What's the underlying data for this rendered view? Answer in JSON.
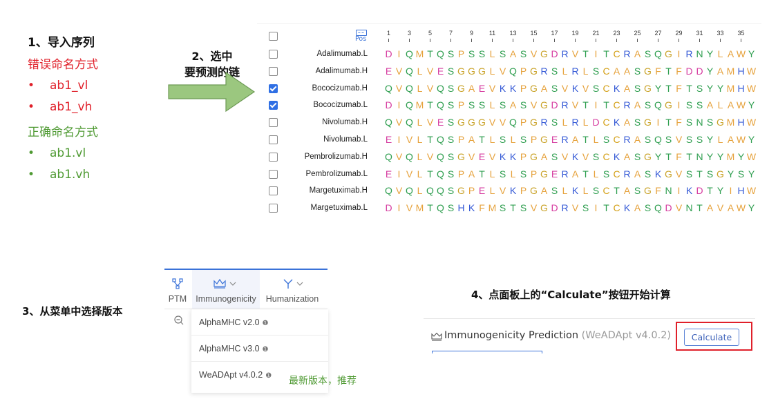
{
  "step1": {
    "heading": "1、导入序列",
    "wrong_title": "错误命名方式",
    "wrong_items": [
      "ab1_vl",
      "ab1_vh"
    ],
    "right_title": "正确命名方式",
    "right_items": [
      "ab1.vl",
      "ab1.vh"
    ]
  },
  "step2": {
    "line1": "2、选中",
    "line2": "要预测的链"
  },
  "sequences": {
    "pos_label": "Pos",
    "ticks": [
      "1",
      "3",
      "5",
      "7",
      "9",
      "11",
      "13",
      "15",
      "17",
      "19",
      "21",
      "23",
      "25",
      "27",
      "29",
      "31",
      "33",
      "35"
    ],
    "rows": [
      {
        "name": "Adalimumab.L",
        "checked": false,
        "seq": "DIQMTQSPSSLSASVGDRVTITCRASQGIRNYLAWY"
      },
      {
        "name": "Adalimumab.H",
        "checked": false,
        "seq": "EVQLVESGGGLVQPGRSLRLSCAASGFTFDDYAMHW"
      },
      {
        "name": "Bococizumab.H",
        "checked": true,
        "seq": "QVQLVQSGAEVKKPGASVKVSCKASGYTFTSYYMHW"
      },
      {
        "name": "Bococizumab.L",
        "checked": true,
        "seq": "DIQMTQSPSSLSASVGDRVTITCRASQGISSALAWY"
      },
      {
        "name": "Nivolumab.H",
        "checked": false,
        "seq": "QVQLVESGGGVVQPGRSLRLDCKASGITFSNSGMHW"
      },
      {
        "name": "Nivolumab.L",
        "checked": false,
        "seq": "EIVLTQSPATLSLSPGERATLSCRASQSVSSYLAWY"
      },
      {
        "name": "Pembrolizumab.H",
        "checked": false,
        "seq": "QVQLVQSGVEVKKPGASVKVSCKASGYTFTNYYMYW"
      },
      {
        "name": "Pembrolizumab.L",
        "checked": false,
        "seq": "EIVLTQSPATLSLSPGERATLSCRASKGVSTSGYSY"
      },
      {
        "name": "Margetuximab.H",
        "checked": false,
        "seq": "QVQLQQSGPELVKPGASLKLSCTASGFNIKDTYIHW"
      },
      {
        "name": "Margetuximab.L",
        "checked": false,
        "seq": "DIVMTQSHKFMSTSVGDRVSITCKASQDVNTAVAWY"
      }
    ]
  },
  "residue_colors": {
    "A": "#e6a23c",
    "V": "#e6a23c",
    "L": "#e6a23c",
    "I": "#e6a23c",
    "M": "#e6a23c",
    "F": "#e6a23c",
    "W": "#e6a23c",
    "P": "#e6a23c",
    "G": "#c9a227",
    "C": "#d4a017",
    "S": "#2e9e4f",
    "T": "#2e9e4f",
    "N": "#2e9e4f",
    "Q": "#2e9e4f",
    "Y": "#2e9e4f",
    "D": "#d63ca0",
    "E": "#d63ca0",
    "K": "#3358d6",
    "R": "#3358d6",
    "H": "#3358d6"
  },
  "step3": {
    "label": "3、从菜单中选择版本",
    "tabs": [
      {
        "label": "PTM",
        "icon": "network-icon"
      },
      {
        "label": "Immunogenicity",
        "icon": "crown-icon"
      },
      {
        "label": "Humanization",
        "icon": "antibody-icon"
      }
    ],
    "menu_items": [
      "AlphaMHC v2.0",
      "AlphaMHC v3.0",
      "WeADApt v4.0.2"
    ],
    "recommend": "最新版本，推荐"
  },
  "step4": {
    "label": "4、点面板上的“Calculate”按钮开始计算",
    "panel_title": "Immunogenicity Prediction",
    "panel_version": "(WeADApt v4.0.2)",
    "button": "Calculate"
  },
  "colors": {
    "wrong": "#e0202a",
    "right": "#4f9a33",
    "accent": "#3a72d8",
    "arrow_fill": "#9bc77f",
    "arrow_stroke": "#6d9a55"
  }
}
